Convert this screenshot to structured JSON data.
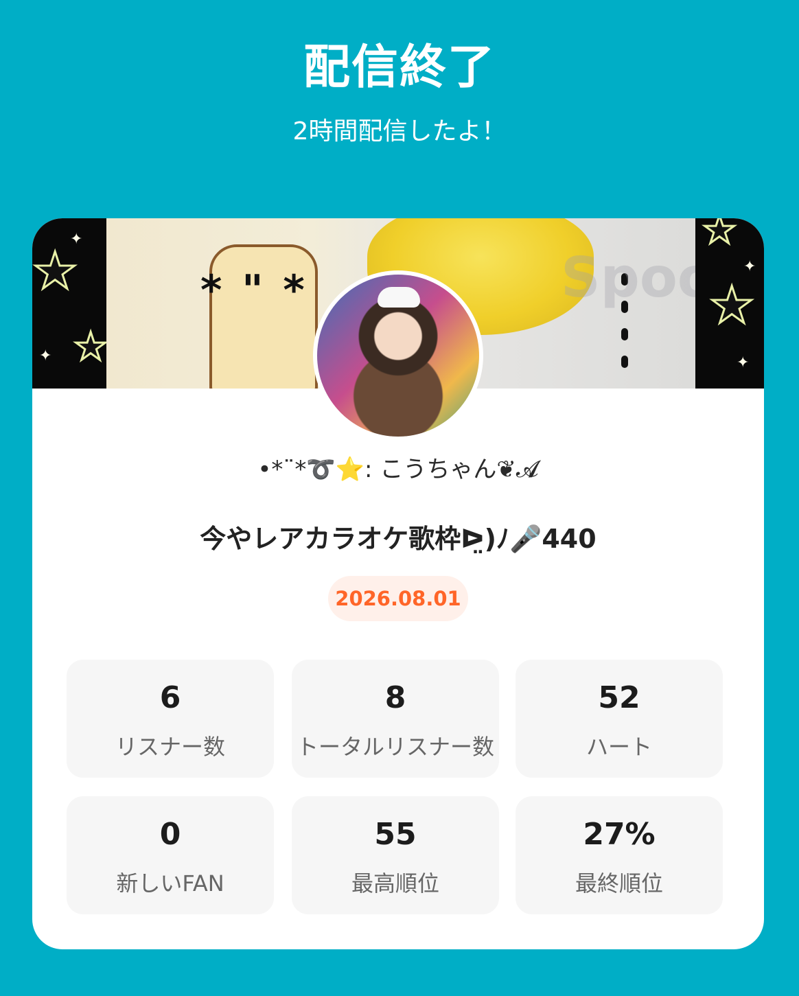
{
  "header": {
    "title": "配信終了",
    "subtitle": "2時間配信したよ！"
  },
  "card": {
    "username": "•*¨*➰⭐️: こうちゃん❦𝓐",
    "live_title": "今やレアカラオケ歌枠ᐅ̤)ﾉ🎤440",
    "date": "2026.08.01",
    "banner_watermark": "Spoon",
    "stats": [
      {
        "value": "6",
        "label": "リスナー数"
      },
      {
        "value": "8",
        "label": "トータルリスナー数"
      },
      {
        "value": "52",
        "label": "ハート"
      },
      {
        "value": "0",
        "label": "新しいFAN"
      },
      {
        "value": "55",
        "label": "最高順位"
      },
      {
        "value": "27%",
        "label": "最終順位"
      }
    ]
  },
  "colors": {
    "background": "#00aec6",
    "date_text": "#ff6528",
    "date_bg": "#fff0ea"
  }
}
